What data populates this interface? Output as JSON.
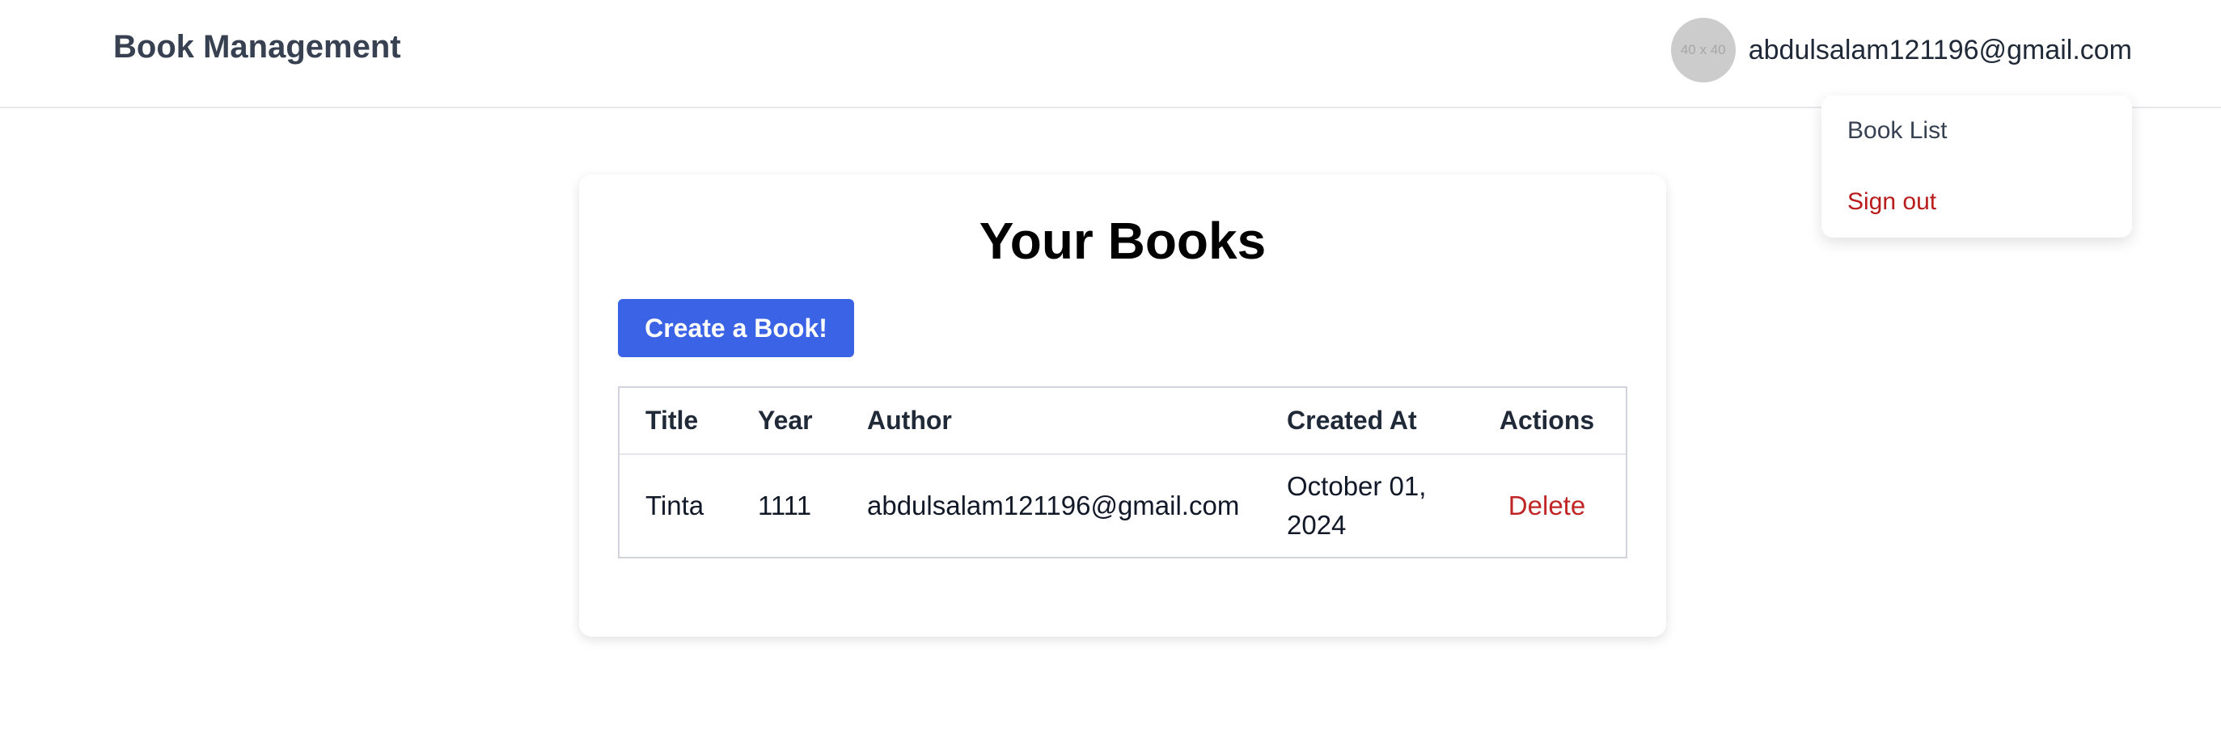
{
  "navbar": {
    "brand": "Book Management",
    "avatar_text": "40 x 40",
    "user_email": "abdulsalam121196@gmail.com"
  },
  "dropdown": {
    "items": [
      {
        "label": "Book List"
      },
      {
        "label": "Sign out"
      }
    ]
  },
  "main": {
    "title": "Your Books",
    "create_button_label": "Create a Book!",
    "table": {
      "headers": [
        "Title",
        "Year",
        "Author",
        "Created At",
        "Actions"
      ],
      "rows": [
        {
          "title": "Tinta",
          "year": "1111",
          "author": "abdulsalam121196@gmail.com",
          "created_at": "October 01, 2024",
          "action_label": "Delete"
        }
      ]
    }
  },
  "colors": {
    "primary_button": "#3b63e6",
    "danger": "#c02626",
    "sign_out": "#b91c1c"
  }
}
